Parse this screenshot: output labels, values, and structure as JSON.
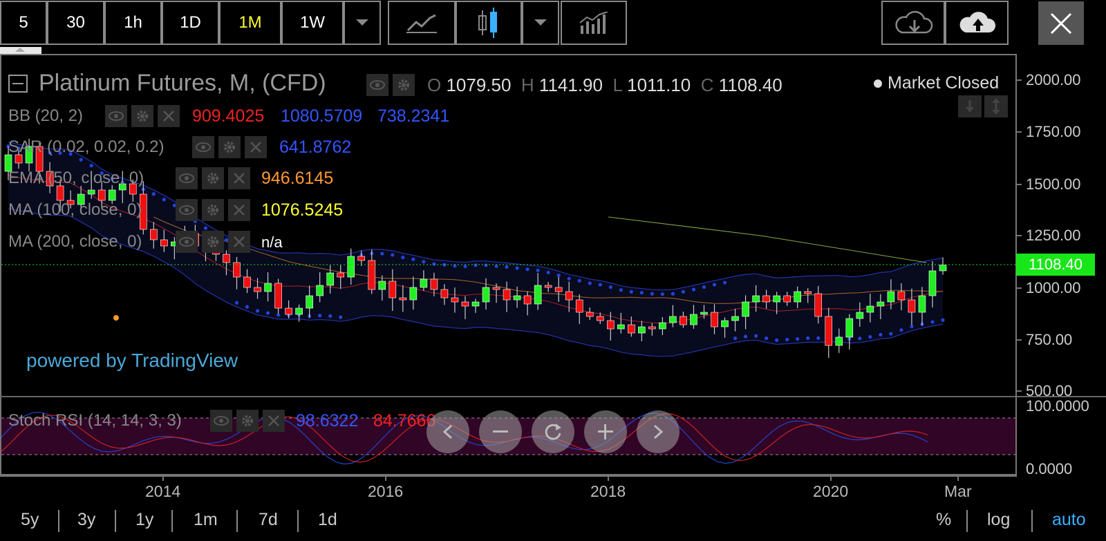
{
  "toolbar": {
    "intervals": [
      {
        "label": "5",
        "active": false
      },
      {
        "label": "30",
        "active": false
      },
      {
        "label": "1h",
        "active": false
      },
      {
        "label": "1D",
        "active": false
      },
      {
        "label": "1M",
        "active": true
      },
      {
        "label": "1W",
        "active": false
      }
    ],
    "icons": [
      "chevron-down-icon",
      "line-chart-icon",
      "candlestick-icon",
      "chevron-down-icon",
      "indicators-icon",
      "cloud-download-icon",
      "cloud-upload-icon",
      "close-icon"
    ]
  },
  "legend": {
    "title": "Platinum Futures, M, (CFD)",
    "ohlc": {
      "o_label": "O",
      "o": "1079.50",
      "h_label": "H",
      "h": "1141.90",
      "l_label": "L",
      "l": "1011.10",
      "c_label": "C",
      "c": "1108.40"
    },
    "market_status": "Market Closed"
  },
  "indicators": [
    {
      "name": "BB (20, 2)",
      "values": [
        "909.4025",
        "1080.5709",
        "738.2341"
      ],
      "colors": [
        "#ee2222",
        "#3355ff",
        "#3355ff"
      ]
    },
    {
      "name": "SAR (0.02, 0.02, 0.2)",
      "values": [
        "641.8762"
      ],
      "colors": [
        "#3355ff"
      ]
    },
    {
      "name": "EMA (50, close, 0)",
      "values": [
        "946.6145"
      ],
      "colors": [
        "#ff9933"
      ]
    },
    {
      "name": "MA (100, close, 0)",
      "values": [
        "1076.5245"
      ],
      "colors": [
        "#ffff33"
      ]
    },
    {
      "name": "MA (200, close, 0)",
      "values": [
        "n/a"
      ],
      "colors": [
        "#ffffff"
      ]
    },
    {
      "name": "Stoch RSI (14, 14, 3, 3)",
      "values": [
        "98.6322",
        "84.7666"
      ],
      "colors": [
        "#3355ff",
        "#ee2222"
      ]
    }
  ],
  "price_axis": {
    "labels": [
      "2000.00",
      "1750.00",
      "1500.00",
      "1250.00",
      "1000.00",
      "750.00",
      "500.00"
    ],
    "last_price": "1108.40",
    "last_price_color": "#19e619"
  },
  "stoch_axis": {
    "labels": [
      "100.0000",
      "0.0000"
    ]
  },
  "time_axis": {
    "labels": [
      "2014",
      "2016",
      "2018",
      "2020",
      "Mar"
    ]
  },
  "watermark": "powered by TradingView",
  "bottom_bar": {
    "ranges": [
      "5y",
      "3y",
      "1y",
      "1m",
      "7d",
      "1d"
    ],
    "percent": "%",
    "log": "log",
    "auto": "auto"
  },
  "chart_data": {
    "type": "candlestick",
    "symbol": "Platinum Futures",
    "interval": "M",
    "ylim": [
      480,
      2050
    ],
    "candles_close_path": [
      1640,
      1600,
      1680,
      1560,
      1490,
      1420,
      1400,
      1450,
      1470,
      1420,
      1470,
      1500,
      1450,
      1280,
      1230,
      1200,
      1220,
      1260,
      1200,
      1180,
      1160,
      1120,
      1050,
      1000,
      980,
      1020,
      900,
      870,
      900,
      960,
      1010,
      1070,
      1050,
      1150,
      1130,
      990,
      1030,
      950,
      940,
      1000,
      1040,
      990,
      950,
      930,
      910,
      930,
      1000,
      990,
      940,
      960,
      920,
      1010,
      1000,
      980,
      940,
      880,
      860,
      840,
      800,
      820,
      780,
      810,
      800,
      830,
      860,
      820,
      870,
      880,
      810,
      840,
      860,
      930,
      960,
      930,
      960,
      930,
      980,
      970,
      860,
      720,
      760,
      850,
      880,
      910,
      930,
      980,
      940,
      880,
      960,
      1080,
      1108
    ]
  }
}
